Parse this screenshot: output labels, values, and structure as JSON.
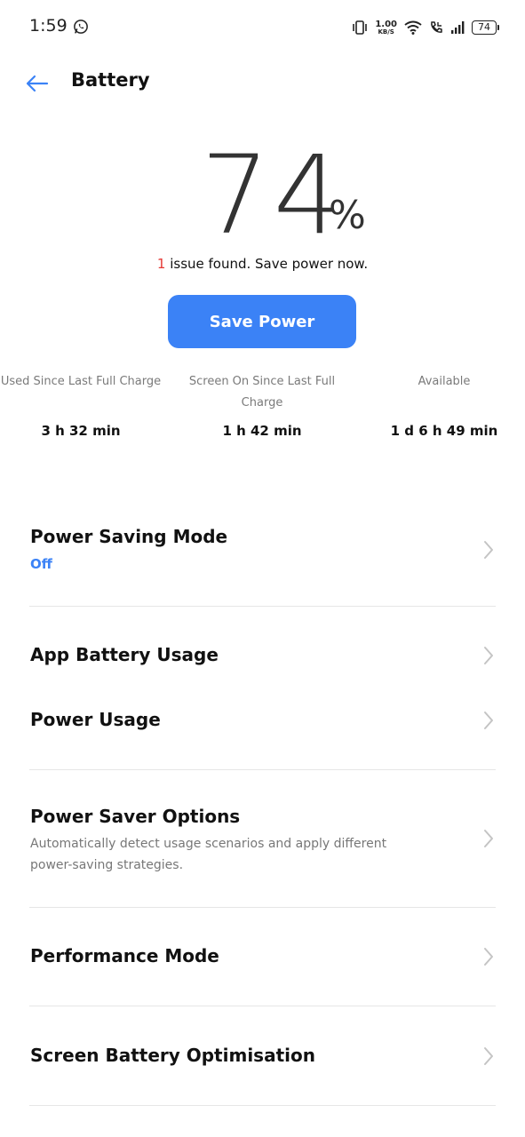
{
  "status_bar": {
    "time": "1:59",
    "speed_value": "1.00",
    "speed_unit": "KB/S",
    "battery_level": "74",
    "icons": [
      "whatsapp-icon",
      "vibrate-icon",
      "wifi-icon",
      "volte-call-icon",
      "signal-icon",
      "battery-icon"
    ]
  },
  "header": {
    "title": "Battery",
    "back_icon": "arrow-left-icon"
  },
  "battery": {
    "percent": "74",
    "percent_sign": "%",
    "issue_count": "1",
    "issue_text": " issue found. Save power now."
  },
  "save_button": {
    "label": "Save Power"
  },
  "stats": [
    {
      "label": "Used Since Last Full Charge",
      "value": "3 h 32 min"
    },
    {
      "label": "Screen On Since Last Full Charge",
      "value": "1 h 42 min"
    },
    {
      "label": "Available",
      "value": "1 d 6 h 49 min"
    }
  ],
  "settings": {
    "power_saving_mode": {
      "title": "Power Saving Mode",
      "status": "Off"
    },
    "app_battery_usage": {
      "title": "App Battery Usage"
    },
    "power_usage": {
      "title": "Power Usage"
    },
    "power_saver_options": {
      "title": "Power Saver Options",
      "description": "Automatically detect usage scenarios and apply different power-saving strategies."
    },
    "performance_mode": {
      "title": "Performance Mode"
    },
    "screen_battery_optimisation": {
      "title": "Screen Battery Optimisation"
    }
  },
  "colors": {
    "accent": "#3b82f6",
    "issue": "#e53935",
    "text": "#111111",
    "muted": "#7a7a7a",
    "divider": "#e6e6e6"
  }
}
